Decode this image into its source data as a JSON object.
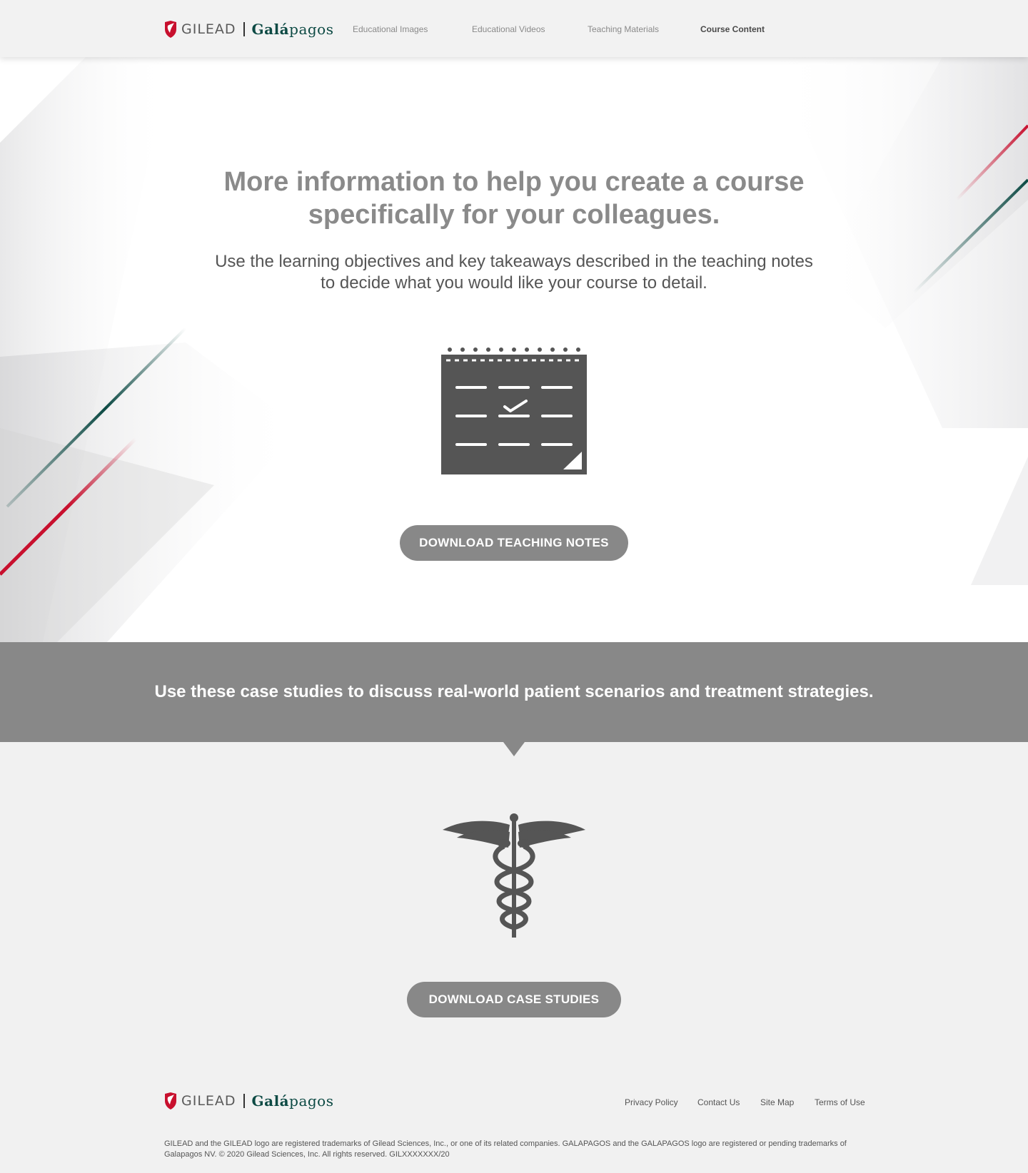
{
  "header": {
    "brand_gilead": "GILEAD",
    "brand_galapagos_first": "Galá",
    "brand_galapagos_rest": "pagos",
    "nav": [
      {
        "label": "Educational Images",
        "active": false
      },
      {
        "label": "Educational Videos",
        "active": false
      },
      {
        "label": "Teaching Materials",
        "active": false
      },
      {
        "label": "Course Content",
        "active": true
      }
    ]
  },
  "hero": {
    "title": "More information to help you create a course specifically for your colleagues.",
    "subtitle": "Use the learning objectives and key takeaways described in the teaching notes to decide what you would like your course to detail.",
    "icon": "calendar-check-icon",
    "button_label": "DOWNLOAD TEACHING NOTES"
  },
  "banner": {
    "text": "Use these case studies to discuss real-world patient scenarios and treatment strategies."
  },
  "cases": {
    "icon": "caduceus-icon",
    "button_label": "DOWNLOAD CASE STUDIES"
  },
  "footer": {
    "brand_gilead": "GILEAD",
    "brand_galapagos_first": "Galá",
    "brand_galapagos_rest": "pagos",
    "links": [
      "Privacy Policy",
      "Contact Us",
      "Site Map",
      "Terms of Use"
    ],
    "legal": "GILEAD and the GILEAD logo are registered trademarks of Gilead Sciences, Inc., or one of its related companies. GALAPAGOS and the GALAPAGOS logo are registered or pending trademarks of Galapagos NV. © 2020 Gilead Sciences, Inc. All rights reserved. GILXXXXXXX/20"
  },
  "colors": {
    "accent_red": "#c8102e",
    "accent_green": "#0d4a44",
    "button_gray": "#888888",
    "banner_gray": "#888888",
    "icon_gray": "#555555"
  }
}
